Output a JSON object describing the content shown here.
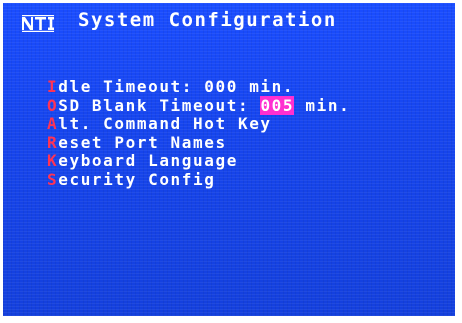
{
  "header": {
    "logo_text": "NTI",
    "title": "System Configuration"
  },
  "menu": {
    "items": [
      {
        "hotkey": "I",
        "label": "dle Timeout: 000 min."
      },
      {
        "hotkey": "O",
        "label": "SD Blank Timeout: ",
        "value": "005",
        "suffix": " min."
      },
      {
        "hotkey": "A",
        "label": "lt. Command Hot Key"
      },
      {
        "hotkey": "R",
        "label": "eset Port Names"
      },
      {
        "hotkey": "K",
        "label": "eyboard Language"
      },
      {
        "hotkey": "S",
        "label": "ecurity Config"
      }
    ]
  },
  "colors": {
    "background": "#1745f0",
    "text": "#ffffff",
    "hotkey": "#ff3355",
    "selected_value_bg": "#ff2fd0"
  }
}
